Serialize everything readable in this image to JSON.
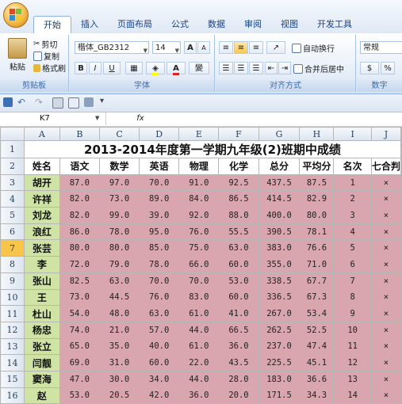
{
  "tabs": [
    "开始",
    "插入",
    "页面布局",
    "公式",
    "数据",
    "审阅",
    "视图",
    "开发工具"
  ],
  "clipboard": {
    "paste": "粘贴",
    "cut": "剪切",
    "copy": "复制",
    "format_painter": "格式刷",
    "label": "剪贴板"
  },
  "font": {
    "name": "楷体_GB2312",
    "size": "14",
    "grow": "A",
    "shrink": "A",
    "bold": "B",
    "italic": "I",
    "underline": "U",
    "label": "字体"
  },
  "alignment": {
    "wrap": "自动换行",
    "merge": "合并后居中",
    "label": "对齐方式"
  },
  "number": {
    "format": "常规",
    "percent": "%",
    "label": "数字"
  },
  "namebox": "K7",
  "fx": "fx",
  "columns": [
    "A",
    "B",
    "C",
    "D",
    "E",
    "F",
    "G",
    "H",
    "I",
    "J"
  ],
  "sheet": {
    "title": "2013-2014年度第一学期九年级(2)班期中成绩",
    "headers": [
      "姓名",
      "语文",
      "数学",
      "英语",
      "物理",
      "化学",
      "总分",
      "平均分",
      "名次",
      "七合判"
    ],
    "rows": [
      [
        "胡开",
        "87.0",
        "97.0",
        "70.0",
        "91.0",
        "92.5",
        "437.5",
        "87.5",
        "1",
        "×"
      ],
      [
        "许祥",
        "82.0",
        "73.0",
        "89.0",
        "84.0",
        "86.5",
        "414.5",
        "82.9",
        "2",
        "×"
      ],
      [
        "刘龙",
        "82.0",
        "99.0",
        "39.0",
        "92.0",
        "88.0",
        "400.0",
        "80.0",
        "3",
        "×"
      ],
      [
        "浪红",
        "86.0",
        "78.0",
        "95.0",
        "76.0",
        "55.5",
        "390.5",
        "78.1",
        "4",
        "×"
      ],
      [
        "张芸",
        "80.0",
        "80.0",
        "85.0",
        "75.0",
        "63.0",
        "383.0",
        "76.6",
        "5",
        "×"
      ],
      [
        "李",
        "72.0",
        "79.0",
        "78.0",
        "66.0",
        "60.0",
        "355.0",
        "71.0",
        "6",
        "×"
      ],
      [
        "张山",
        "82.5",
        "63.0",
        "70.0",
        "70.0",
        "53.0",
        "338.5",
        "67.7",
        "7",
        "×"
      ],
      [
        "王",
        "73.0",
        "44.5",
        "76.0",
        "83.0",
        "60.0",
        "336.5",
        "67.3",
        "8",
        "×"
      ],
      [
        "杜山",
        "54.0",
        "48.0",
        "63.0",
        "61.0",
        "41.0",
        "267.0",
        "53.4",
        "9",
        "×"
      ],
      [
        "杨忠",
        "74.0",
        "21.0",
        "57.0",
        "44.0",
        "66.5",
        "262.5",
        "52.5",
        "10",
        "×"
      ],
      [
        "张立",
        "65.0",
        "35.0",
        "40.0",
        "61.0",
        "36.0",
        "237.0",
        "47.4",
        "11",
        "×"
      ],
      [
        "闫靓",
        "69.0",
        "31.0",
        "60.0",
        "22.0",
        "43.5",
        "225.5",
        "45.1",
        "12",
        "×"
      ],
      [
        "窦海",
        "47.0",
        "30.0",
        "34.0",
        "44.0",
        "28.0",
        "183.0",
        "36.6",
        "13",
        "×"
      ],
      [
        "赵",
        "53.0",
        "20.5",
        "42.0",
        "36.0",
        "20.0",
        "171.5",
        "34.3",
        "14",
        "×"
      ]
    ]
  },
  "row_numbers": [
    "1",
    "2",
    "3",
    "4",
    "5",
    "6",
    "7",
    "8",
    "9",
    "10",
    "11",
    "12",
    "13",
    "14",
    "15",
    "16"
  ]
}
